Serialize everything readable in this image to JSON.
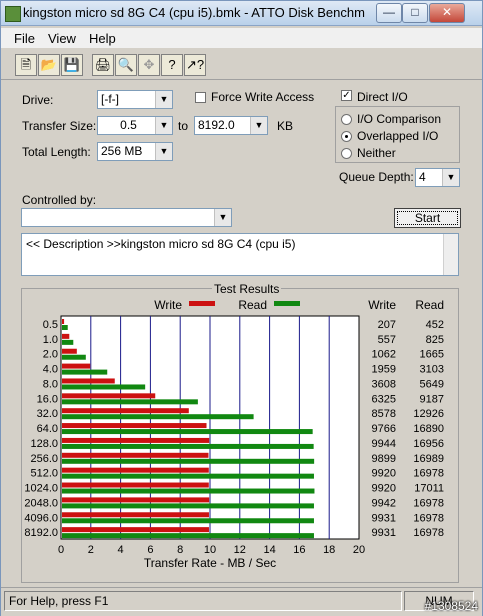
{
  "window": {
    "title": "kingston micro sd 8G C4 (cpu i5).bmk - ATTO Disk Benchm"
  },
  "menu": {
    "file": "File",
    "view": "View",
    "help": "Help"
  },
  "form": {
    "drive_label": "Drive:",
    "drive_value": "[-f-]",
    "force_write": "Force Write Access",
    "direct_io": "Direct I/O",
    "direct_io_checked": true,
    "transfer_size_label": "Transfer Size:",
    "ts_from": "0.5",
    "to_label": "to",
    "ts_to": "8192.0",
    "kb_label": "KB",
    "total_length_label": "Total Length:",
    "total_length_value": "256 MB",
    "io_comparison": "I/O Comparison",
    "overlapped_io": "Overlapped I/O",
    "neither": "Neither",
    "queue_depth_label": "Queue Depth:",
    "queue_depth_value": "4",
    "controlled_by_label": "Controlled by:",
    "controlled_by_value": "",
    "start_label": "Start",
    "description": "<< Description >>kingston micro sd 8G C4 (cpu i5)"
  },
  "results": {
    "label": "Test Results",
    "write_legend": "Write",
    "read_legend": "Read",
    "write_col": "Write",
    "read_col": "Read",
    "xlabel": "Transfer Rate - MB / Sec"
  },
  "chart_data": {
    "type": "bar",
    "categories": [
      "0.5",
      "1.0",
      "2.0",
      "4.0",
      "8.0",
      "16.0",
      "32.0",
      "64.0",
      "128.0",
      "256.0",
      "512.0",
      "1024.0",
      "2048.0",
      "4096.0",
      "8192.0"
    ],
    "series": [
      {
        "name": "Write",
        "color": "#cc1111",
        "values": [
          207,
          557,
          1062,
          1959,
          3608,
          6325,
          8578,
          9766,
          9944,
          9899,
          9920,
          9920,
          9942,
          9931,
          9931
        ]
      },
      {
        "name": "Read",
        "color": "#118811",
        "values": [
          452,
          825,
          1665,
          3103,
          5649,
          9187,
          12926,
          16890,
          16956,
          16989,
          16978,
          17011,
          16978,
          16978,
          16978
        ]
      }
    ],
    "xticks": [
      "0",
      "2",
      "4",
      "6",
      "8",
      "10",
      "12",
      "14",
      "16",
      "18",
      "20"
    ],
    "xlim": [
      0,
      20
    ],
    "xlabel": "Transfer Rate - MB / Sec",
    "grid": true,
    "legend": "top"
  },
  "statusbar": {
    "help": "For Help, press F1",
    "num": "NUM"
  },
  "watermark": "#1308524"
}
